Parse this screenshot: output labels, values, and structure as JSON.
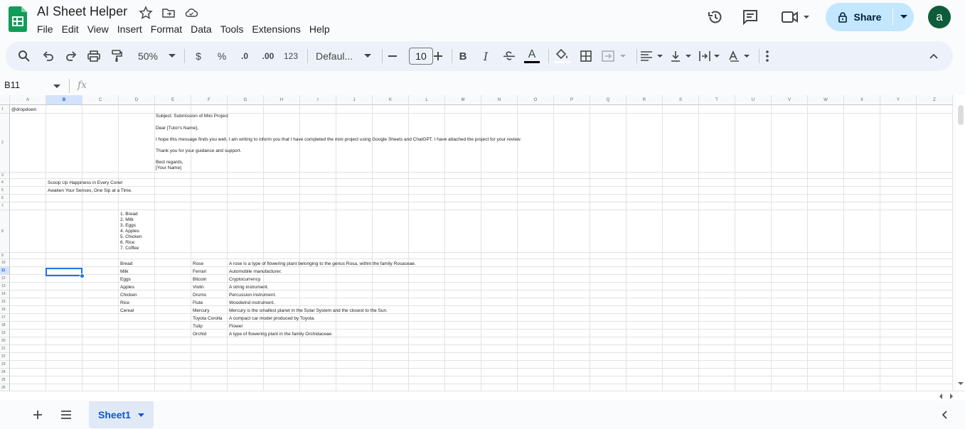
{
  "app": {
    "title": "AI Sheet Helper",
    "menu": [
      "File",
      "Edit",
      "View",
      "Insert",
      "Format",
      "Data",
      "Tools",
      "Extensions",
      "Help"
    ],
    "share_label": "Share",
    "avatar_letter": "a"
  },
  "toolbar": {
    "zoom": "50%",
    "currency": "$",
    "percent": "%",
    "decrease_decimal": ".0",
    "increase_decimal": ".00",
    "number_format": "123",
    "font": "Defaul...",
    "font_size": "10",
    "bold": "B",
    "italic": "I",
    "text_color": "A"
  },
  "formula_bar": {
    "name_box": "B11",
    "fx": "fx"
  },
  "columns": [
    "A",
    "B",
    "C",
    "D",
    "E",
    "F",
    "G",
    "H",
    "I",
    "J",
    "K",
    "L",
    "M",
    "N",
    "O",
    "P",
    "Q",
    "R",
    "S",
    "T",
    "U",
    "V",
    "W",
    "X",
    "Y",
    "Z"
  ],
  "rows": [
    "1",
    "2",
    "3",
    "4",
    "5",
    "6",
    "7",
    "8",
    "9",
    "10",
    "11",
    "12",
    "13",
    "14",
    "15",
    "16",
    "17",
    "18",
    "19",
    "20",
    "21",
    "22",
    "23",
    "24",
    "25",
    "26"
  ],
  "cells": {
    "a1": "@dropdown",
    "e2_subject": "Subject: Submission of Mini Project",
    "e2_dear": "Dear [Tutor's Name],",
    "e2_body": "I hope this message finds you well. I am writing to inform you that I have completed the mini project using Google Sheets and ChatGPT. I have attached the project for your review.",
    "e2_thanks": "Thank you for your guidance and support.",
    "e2_regards": "Best regards,",
    "e2_name": "[Your Name]",
    "b4": "Scoop Up Happiness in Every Cone!",
    "b5": "Awaken Your Senses, One Sip at a Time.",
    "d8_list": [
      "1. Bread",
      "2. Milk",
      "3. Eggs",
      "4. Apples",
      "5. Chicken",
      "6. Rice",
      "7. Coffee"
    ],
    "d_items": [
      "Bread",
      "Milk",
      "Eggs",
      "Apples",
      "Chicken",
      "Rice",
      "Cereal"
    ],
    "f_items": [
      "Rose",
      "Ferrari",
      "Bitcoin",
      "Violin",
      "Drums",
      "Flute",
      "Mercury",
      "Toyota Corolla",
      "Tulip",
      "Orchid"
    ],
    "g_items": [
      "A rose is a type of flowering plant belonging to the genus Rosa, within the family Rosaceae.",
      "Automobile manufacturer.",
      "Cryptocurrency.",
      "A string instrument.",
      "Percussion instrument.",
      "Woodwind instrument.",
      "Mercury is the smallest planet in the Solar System and the closest to the Sun.",
      "A compact car model produced by Toyota.",
      "Flower",
      "A type of flowering plant in the family Orchidaceae."
    ]
  },
  "sheet_tab": "Sheet1",
  "colors": {
    "accent": "#1a73e8",
    "share_bg": "#c2e7ff",
    "avatar_bg": "#0d5c3b",
    "toolbar_bg": "#edf2fa"
  }
}
